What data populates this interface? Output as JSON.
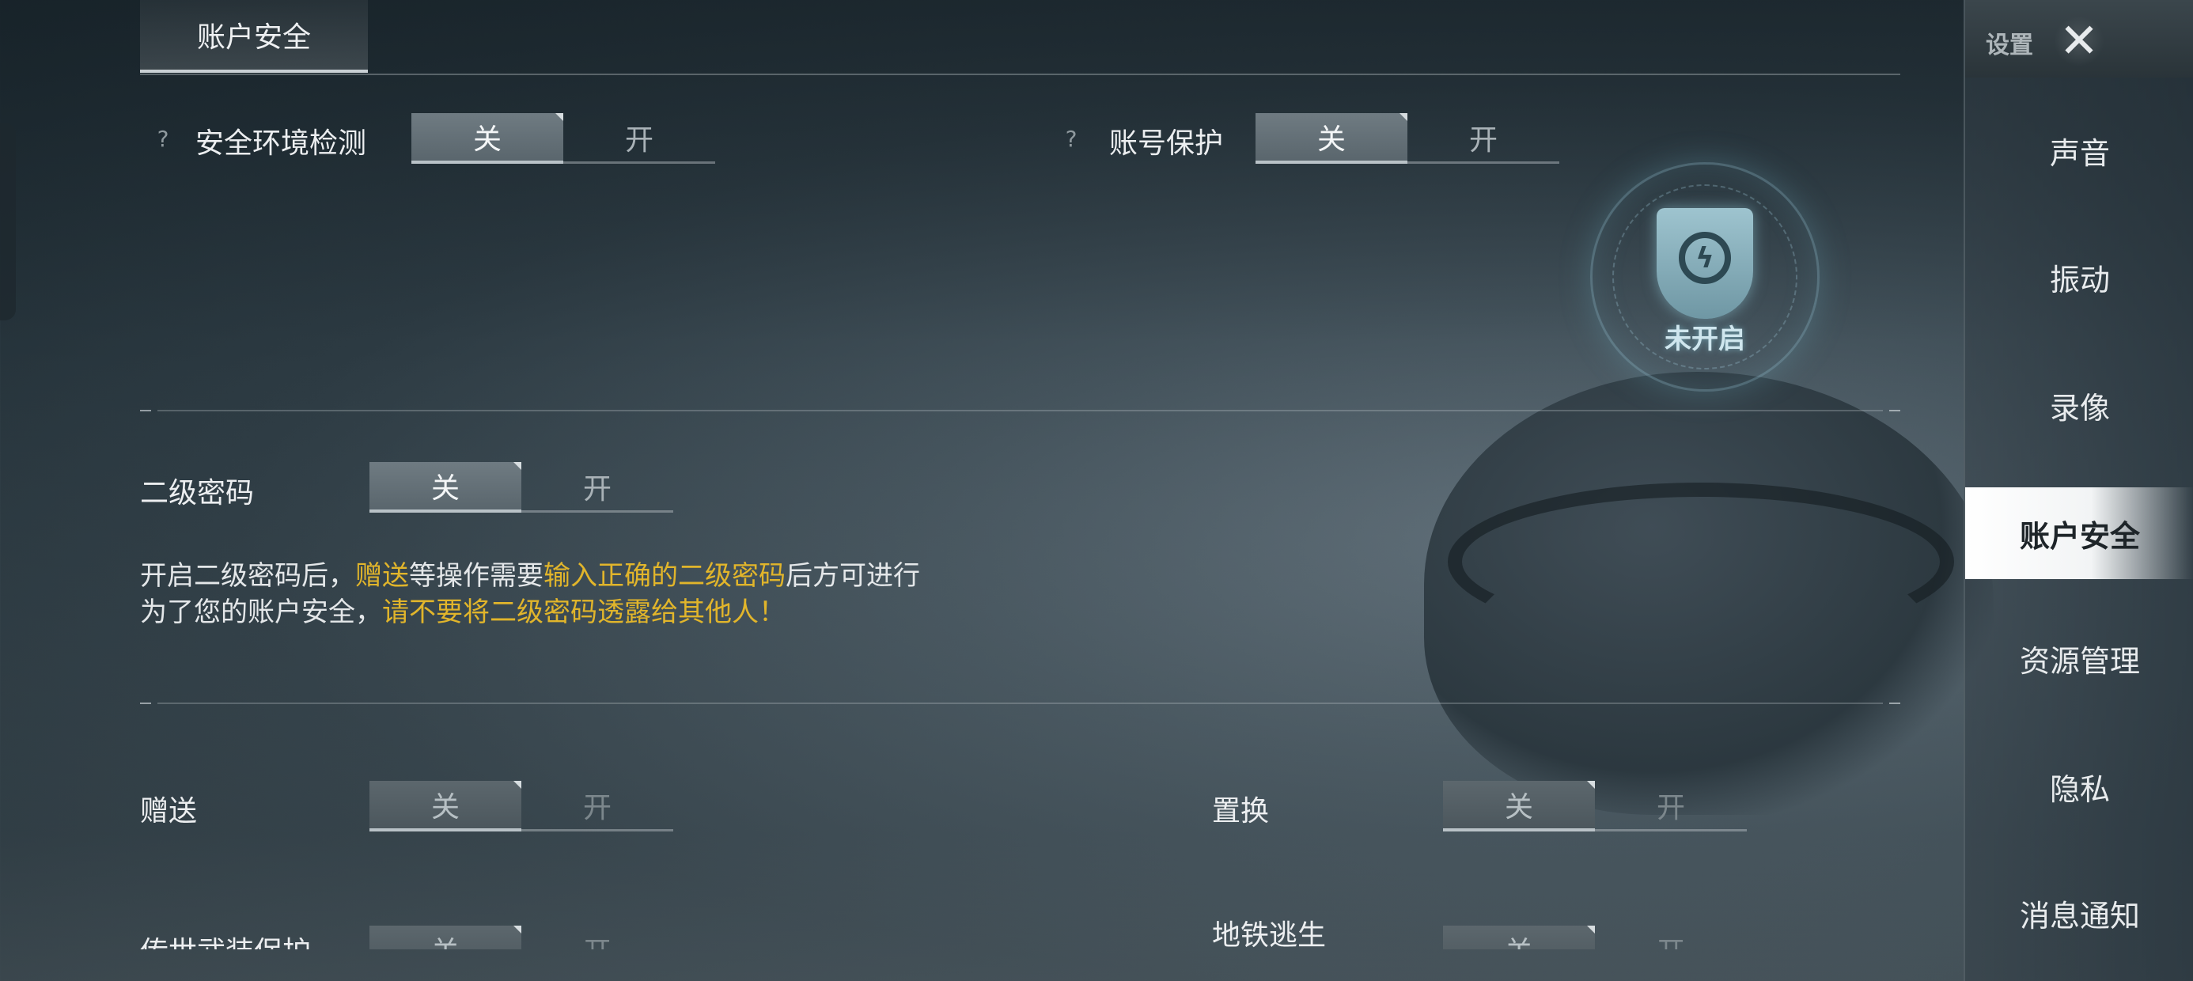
{
  "header": {
    "tab": "账户安全"
  },
  "toggle_labels": {
    "off": "关",
    "on": "开"
  },
  "security_env": {
    "help": "?",
    "label": "安全环境检测",
    "state": "off"
  },
  "account_protect": {
    "help": "?",
    "label": "账号保护",
    "state": "off"
  },
  "badge": {
    "status": "未开启",
    "icon": "shield-lightning-icon"
  },
  "second_password": {
    "label": "二级密码",
    "state": "off",
    "desc_line1": [
      "开启二级密码后，",
      "赠送",
      "等操作需要",
      "输入正确的二级密码",
      "后方可进行"
    ],
    "desc_line2": [
      "为了您的账户安全，",
      "请不要将二级密码透露给其他人！"
    ]
  },
  "options": {
    "gift": {
      "label": "赠送",
      "state": "off"
    },
    "swap": {
      "label": "置换",
      "state": "off"
    },
    "legend_gear": {
      "label": "传世武装保护",
      "state": "off"
    },
    "metro": {
      "label": "地铁逃生",
      "state": "off"
    }
  },
  "sidebar": {
    "title": "设置",
    "close_icon": "close-icon",
    "items": [
      {
        "label": "声音"
      },
      {
        "label": "振动"
      },
      {
        "label": "录像"
      },
      {
        "label": "账户安全",
        "active": true
      },
      {
        "label": "资源管理"
      },
      {
        "label": "隐私"
      },
      {
        "label": "消息通知"
      }
    ]
  },
  "colors": {
    "highlight": "#e1b52b",
    "active_tab_bg": "#ffffff"
  }
}
